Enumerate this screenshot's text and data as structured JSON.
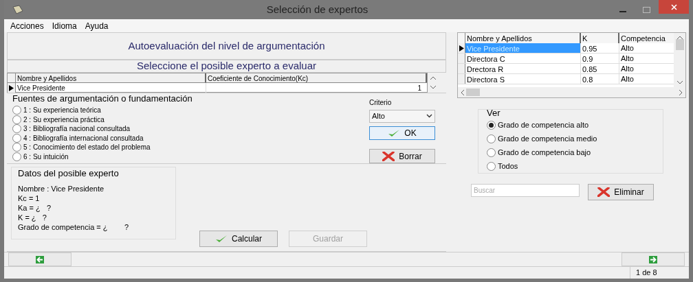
{
  "window": {
    "title": "Selección de expertos"
  },
  "menu": [
    {
      "label": "Acciones"
    },
    {
      "label": "Idioma"
    },
    {
      "label": "Ayuda"
    }
  ],
  "heading": "Autoevaluación del nivel de argumentación",
  "subheading": "Seleccione el posible experto a evaluar",
  "expert_table": {
    "columns": [
      "Nombre y Apellidos",
      "Coeficiente de Conocimiento(Kc)"
    ],
    "rows": [
      {
        "selected": true,
        "cells": [
          "Vice Presidente",
          "1"
        ]
      }
    ]
  },
  "sources": {
    "title": "Fuentes de argumentación o fundamentación",
    "options": [
      {
        "label": "1 : Su experiencia teórica",
        "selected": false
      },
      {
        "label": "2 : Su experiencia práctica",
        "selected": false
      },
      {
        "label": "3 : Bibliografía nacional consultada",
        "selected": false
      },
      {
        "label": "4 : Bibliografía internacional consultada",
        "selected": false
      },
      {
        "label": "5 : Conocimiento del estado del problema",
        "selected": false
      },
      {
        "label": "6 : Su intuición",
        "selected": false
      }
    ]
  },
  "criterio": {
    "label": "Criterio",
    "value": "Alto"
  },
  "ok_button": {
    "label": "OK"
  },
  "borrar_button": {
    "label": "Borrar"
  },
  "datos": {
    "title": "Datos del posible experto",
    "lines": [
      "Nombre : Vice Presidente",
      "Kc = 1",
      "Ka = ¿   ?",
      "K = ¿   ?",
      "Grado de competencia = ¿        ?"
    ]
  },
  "calcular_button": {
    "label": "Calcular",
    "disabled": false
  },
  "guardar_button": {
    "label": "Guardar",
    "disabled": true
  },
  "results_table": {
    "columns": [
      "Nombre y Apellidos",
      "K",
      "Competencia"
    ],
    "rows": [
      {
        "selected": true,
        "cells": [
          "Vice Presidente",
          "0.95",
          "Alto"
        ]
      },
      {
        "selected": false,
        "cells": [
          "Directora C",
          "0.9",
          "Alto"
        ]
      },
      {
        "selected": false,
        "cells": [
          "Drectora R",
          "0.85",
          "Alto"
        ]
      },
      {
        "selected": false,
        "cells": [
          "Directora S",
          "0.8",
          "Alto"
        ]
      }
    ]
  },
  "ver": {
    "title": "Ver",
    "options": [
      {
        "label": "Grado de competencia alto",
        "selected": true
      },
      {
        "label": "Grado de competencia medio",
        "selected": false
      },
      {
        "label": "Grado de competencia bajo",
        "selected": false
      },
      {
        "label": "Todos",
        "selected": false
      }
    ]
  },
  "search": {
    "placeholder": "Buscar"
  },
  "eliminar_button": {
    "label": "Eliminar"
  },
  "status_bar": {
    "page": "1 de 8"
  }
}
